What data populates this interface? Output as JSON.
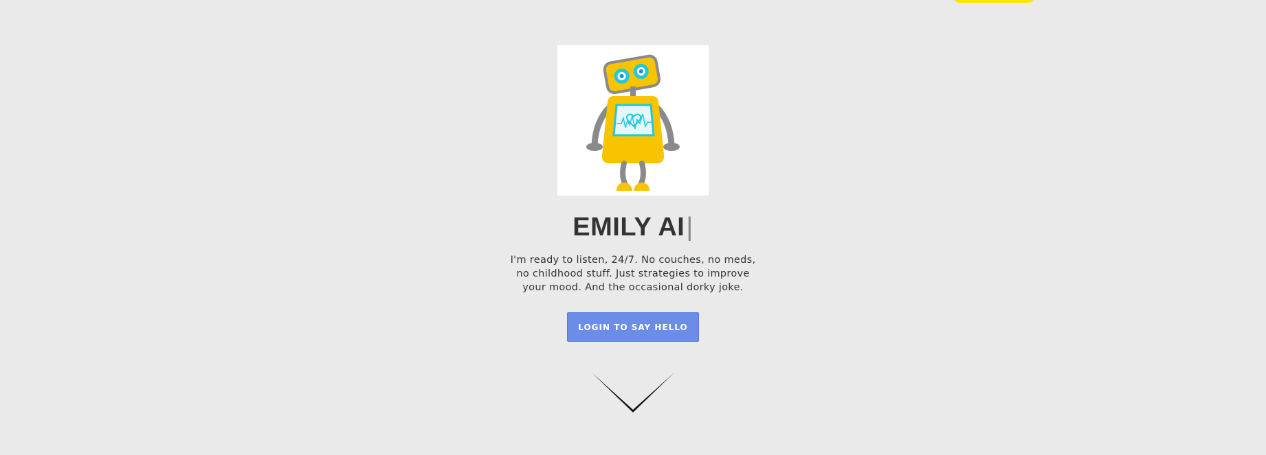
{
  "hero": {
    "title": "EMILY AI",
    "cursor": "|",
    "tagline": "I'm ready to listen, 24/7. No couches, no meds, no childhood stuff. Just strategies to improve your mood. And the occasional dorky joke.",
    "login_label": "LOGIN TO SAY HELLO",
    "avatar_icon": "robot-mascot-icon",
    "scroll_icon": "chevron-down-icon"
  },
  "colors": {
    "background": "#eaeaea",
    "accent_yellow": "#ffe400",
    "button_blue": "#6b8de8",
    "robot_body": "#f8c400",
    "robot_gray": "#8a8a8a",
    "robot_cyan": "#1ec8e0"
  }
}
